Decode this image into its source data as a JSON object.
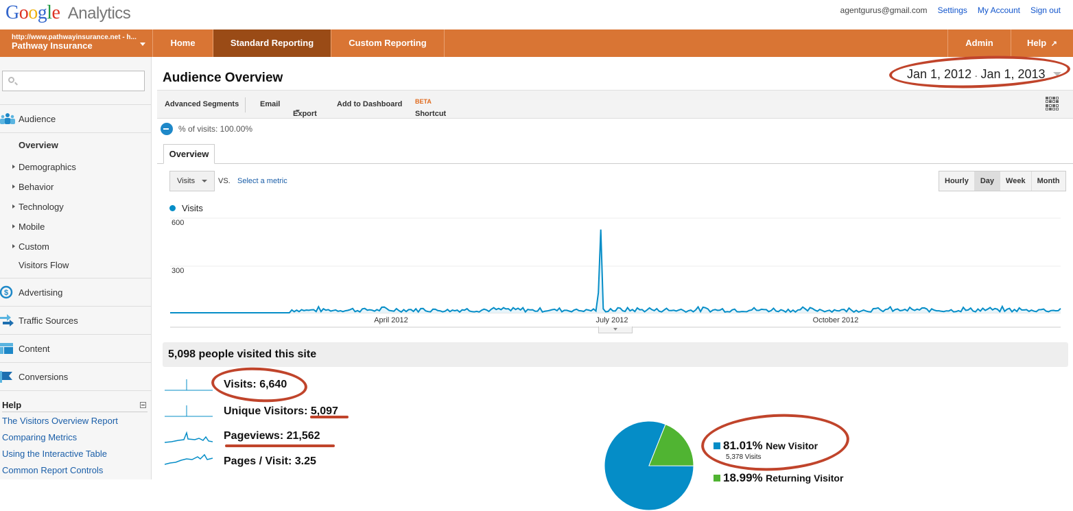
{
  "app": {
    "logo_google": "Google",
    "logo_product": "Analytics"
  },
  "user": {
    "email": "agentgurus@gmail.com",
    "links": [
      "Settings",
      "My Account",
      "Sign out"
    ]
  },
  "nav": {
    "account_url": "http://www.pathwayinsurance.net - h...",
    "account_name": "Pathway Insurance",
    "items": [
      "Home",
      "Standard Reporting",
      "Custom Reporting"
    ],
    "active": "Standard Reporting",
    "right_items": [
      "Admin",
      "Help"
    ]
  },
  "sidebar": {
    "search_placeholder": "",
    "audience": "Audience",
    "audience_items": [
      {
        "label": "Overview",
        "expandable": false,
        "selected": true
      },
      {
        "label": "Demographics",
        "expandable": true
      },
      {
        "label": "Behavior",
        "expandable": true
      },
      {
        "label": "Technology",
        "expandable": true
      },
      {
        "label": "Mobile",
        "expandable": true
      },
      {
        "label": "Custom",
        "expandable": true
      },
      {
        "label": "Visitors Flow",
        "expandable": false
      }
    ],
    "sections": [
      "Advertising",
      "Traffic Sources",
      "Content",
      "Conversions"
    ],
    "help_title": "Help",
    "help_links": [
      "The Visitors Overview Report",
      "Comparing Metrics",
      "Using the Interactive Table",
      "Common Report Controls"
    ]
  },
  "report": {
    "title": "Audience Overview",
    "date_start": "Jan 1, 2012",
    "date_sep": "-",
    "date_end": "Jan 1, 2013",
    "toolbar": [
      "Advanced Segments",
      "Email",
      "Export",
      "Add to Dashboard",
      "Shortcut"
    ],
    "beta": "BETA",
    "segment_label": "% of visits: 100.00%",
    "tab": "Overview",
    "metric": "Visits",
    "vs": "VS.",
    "select_metric": "Select a metric",
    "granularity": [
      "Hourly",
      "Day",
      "Week",
      "Month"
    ],
    "granularity_active": "Day",
    "summary": "5,098 people visited this site",
    "stats": [
      {
        "label": "Visits:",
        "value": "6,640"
      },
      {
        "label": "Unique Visitors:",
        "value": "5,097"
      },
      {
        "label": "Pageviews:",
        "value": "21,562"
      },
      {
        "label": "Pages / Visit:",
        "value": "3.25"
      }
    ],
    "visitor_types": [
      {
        "pct": "81.01%",
        "label": "New Visitor",
        "visits": "5,378 Visits",
        "color": "#058dc7"
      },
      {
        "pct": "18.99%",
        "label": "Returning Visitor",
        "color": "#50b432"
      }
    ]
  },
  "colors": {
    "nav_orange": "#d97534",
    "nav_active": "#9a4b16",
    "series_blue": "#058dc7",
    "annotation_red": "#c0442b"
  },
  "chart_data": {
    "type": "line",
    "series": [
      {
        "name": "Visits",
        "summary": "near zero Jan-Feb 2012, ~20-40/day Mar-Dec, spike ~580 in late June 2012"
      }
    ],
    "x_range": [
      "2012-01-01",
      "2013-01-01"
    ],
    "x_tick_labels": [
      "April 2012",
      "July 2012",
      "October 2012"
    ],
    "y_tick_labels": [
      "300",
      "600"
    ],
    "ylim": [
      0,
      650
    ],
    "spike": {
      "date": "2012-06-26",
      "value": 580
    },
    "baseline_start": "2012-02-20",
    "typical_range": [
      5,
      45
    ]
  },
  "pie_data": {
    "type": "pie",
    "slices": [
      {
        "label": "New Visitor",
        "value": 81.01
      },
      {
        "label": "Returning Visitor",
        "value": 18.99
      }
    ]
  }
}
